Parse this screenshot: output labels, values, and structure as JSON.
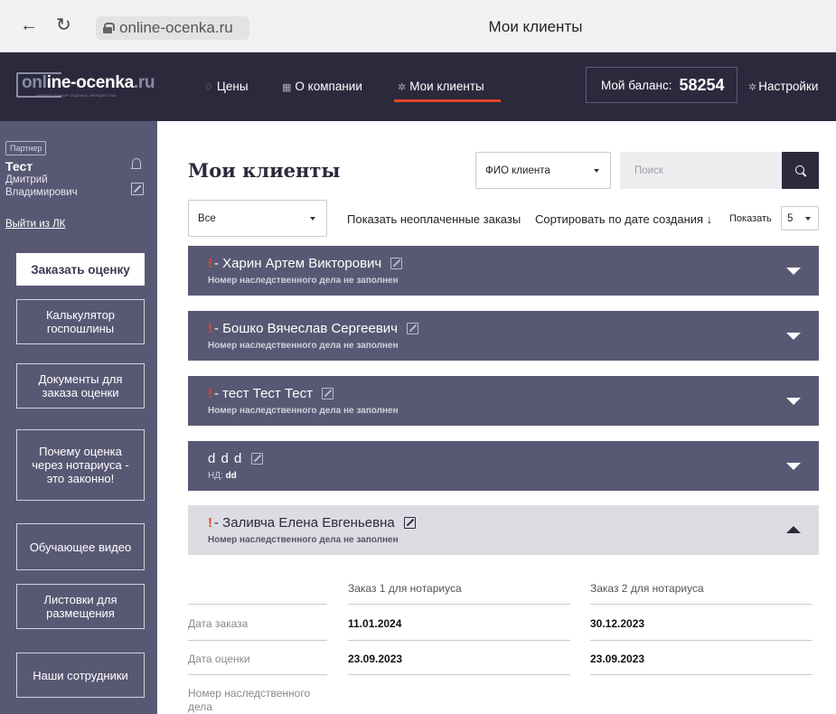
{
  "browser": {
    "url": "online-ocenka.ru",
    "title": "Мои клиенты"
  },
  "header": {
    "logo_part1": "onl",
    "logo_part2": "ine-ocenka",
    "logo_part3": ".ru",
    "logo_sub": "ЭФФЕКТИВНАЯ ОЦЕНКА ИМУЩЕСТВА",
    "nav": [
      {
        "label": "Цены"
      },
      {
        "label": "О компании"
      },
      {
        "label": "Мои клиенты",
        "active": true
      }
    ],
    "balance_label": "Мой баланс:",
    "balance_value": "58254",
    "settings_label": "Настройки",
    "accent_color": "#e2452b",
    "header_color": "#2b2a3d"
  },
  "sidebar": {
    "badge": "Партнер",
    "user_short": "Тест",
    "user_full": "Дмитрий Владимирович",
    "logout": "Выйти из ЛК",
    "buttons": [
      {
        "label": "Заказать оценку"
      },
      {
        "label": "Калькулятор госпошлины"
      },
      {
        "label": "Документы для заказа оценки"
      },
      {
        "label": "Почему оценка через нотариуса - это законно!"
      },
      {
        "label": "Обучающее видео"
      },
      {
        "label": "Листовки для размещения"
      },
      {
        "label": "Наши сотрудники"
      }
    ],
    "color": "#595874"
  },
  "main": {
    "title": "Мои клиенты",
    "search_field_select": "ФИО клиента",
    "search_placeholder": "Поиск",
    "status_filter": "Все",
    "unpaid_link": "Показать неоплаченные заказы",
    "sort_link": "Сортировать по дате создания ↓",
    "show_label": "Показать",
    "show_value": "5"
  },
  "clients": [
    {
      "excl": "!",
      "name": "- Харин Артем Викторович",
      "sub": "Номер наследственного дела не заполнен"
    },
    {
      "excl": "!",
      "name": "- Бошко Вячеслав Сергеевич",
      "sub": "Номер наследственного дела не заполнен"
    },
    {
      "excl": "!",
      "name": "- тест Тест Тест",
      "sub": "Номер наследственного дела не заполнен"
    },
    {
      "excl": "",
      "name": "d d d",
      "nd_label": "НД:",
      "nd_value": "dd"
    },
    {
      "excl": "!",
      "name": "- Заливча Елена Евгеньевна",
      "sub": "Номер наследственного дела не заполнен",
      "expanded": true
    }
  ],
  "details": {
    "columns": [
      "Заказ 1 для нотариуса",
      "Заказ 2 для нотариуса"
    ],
    "rows": [
      {
        "label": "Дата заказа",
        "values": [
          "11.01.2024",
          "30.12.2023"
        ]
      },
      {
        "label": "Дата оценки",
        "values": [
          "23.09.2023",
          "23.09.2023"
        ]
      },
      {
        "label": "Номер наследственного дела",
        "values": [
          "",
          ""
        ]
      }
    ]
  }
}
